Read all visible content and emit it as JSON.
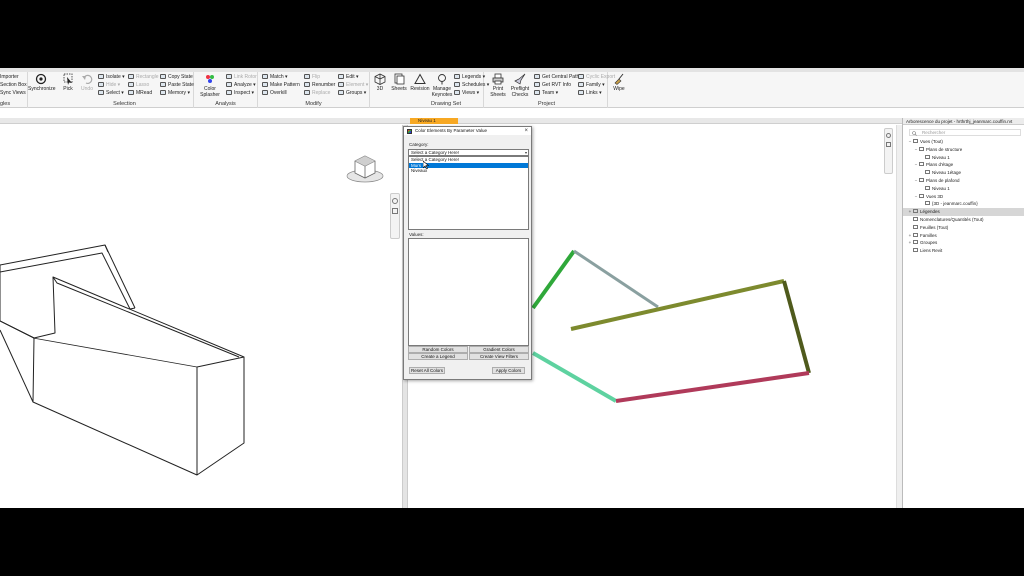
{
  "ribbon": {
    "partial_left": [
      {
        "label": "Importer"
      },
      {
        "label": "Section Box"
      },
      {
        "label": "Sync Views"
      },
      {
        "label": "gles"
      }
    ],
    "synchronize": "Synchronize",
    "pick": "Pick",
    "undo": "Undo",
    "isolate": "Isolate",
    "hide": "Hide",
    "select": "Select",
    "selection_label": "Selection",
    "copy_state": "Copy State",
    "paste_state": "Paste State",
    "memory": "Memory",
    "misc_items": [
      "Rectangle",
      "Lasso",
      "MRead"
    ],
    "color_splasher": "Color Splasher",
    "analysis_items": [
      "Link Rotor",
      "Analyze",
      "Inspect"
    ],
    "analysis_label": "Analysis",
    "match": "Match",
    "make_pattern": "Make Pattern",
    "overkill": "Overkill",
    "renumber": "Renumber",
    "modify_items": [
      "Flip",
      "Replace"
    ],
    "modify_label": "Modify",
    "edit": "Edit",
    "element": "Element",
    "groups": "Groups",
    "threed": "3D",
    "sheets": "Sheets",
    "revision": "Revision",
    "manage_keynotes": "Manage Keynotes",
    "legends": "Legends",
    "schedules": "Schedules",
    "views": "Views",
    "drawing_set_label": "Drawing Set",
    "print_sheets": "Print Sheets",
    "preflight_checks": "Preflight Checks",
    "get_central_path": "Get Central Path",
    "get_rvt_info": "Get RVT Info",
    "team": "Team",
    "cyclic_export": "Cyclic Export",
    "family": "Family",
    "links": "Links",
    "project_label": "Project",
    "wipe": "Wipe"
  },
  "view_tab": {
    "label": "Niveau 1"
  },
  "dialog": {
    "title": "Color Elements By Parameter Value",
    "category_label": "Category:",
    "category_selected": "Select a Category Here!",
    "category_options": [
      "Select a Category Here!",
      "Murs",
      "Niveaux"
    ],
    "highlighted_option": "Murs",
    "values_label": "Values:",
    "random_colors": "Random Colors",
    "gradient_colors": "Gradient Colors",
    "create_legend": "Create a Legend",
    "create_view_filters": "Create View Filters",
    "reset_all_colors": "Reset All Colors",
    "apply_colors": "Apply Colors"
  },
  "browser": {
    "title": "Arborescence du projet - hrthrthj_jeanmarc.couffin.rvt",
    "search_placeholder": "Rechercher",
    "tree": [
      {
        "label": "Vues (Tout)",
        "level": 0,
        "toggle": "−"
      },
      {
        "label": "Plans de structure",
        "level": 1,
        "toggle": "−"
      },
      {
        "label": "Niveau 1",
        "level": 2,
        "toggle": ""
      },
      {
        "label": "Plans d'étage",
        "level": 1,
        "toggle": "−"
      },
      {
        "label": "Niveau 1étage",
        "level": 2,
        "toggle": ""
      },
      {
        "label": "Plans de plafond",
        "level": 1,
        "toggle": "−"
      },
      {
        "label": "Niveau 1",
        "level": 2,
        "toggle": ""
      },
      {
        "label": "Vues 3D",
        "level": 1,
        "toggle": "−"
      },
      {
        "label": "{3D - jeanmarc.couffin}",
        "level": 2,
        "toggle": ""
      },
      {
        "label": "Légendes",
        "level": 0,
        "toggle": "+"
      },
      {
        "label": "Nomenclatures/Quantités (Tout)",
        "level": 0,
        "toggle": ""
      },
      {
        "label": "Feuilles (Tout)",
        "level": 0,
        "toggle": ""
      },
      {
        "label": "Familles",
        "level": 0,
        "toggle": "+"
      },
      {
        "label": "Groupes",
        "level": 0,
        "toggle": "+"
      },
      {
        "label": "Liens Revit",
        "level": 0,
        "toggle": ""
      }
    ],
    "selected_index": 9
  },
  "colors": {
    "wall_green": "#2fa83a",
    "wall_gray": "#8aa0a0",
    "wall_olive": "#7d8a2e",
    "wall_dark_olive": "#4f5a1c",
    "wall_mint": "#5ed2a0",
    "wall_red": "#b03a5a",
    "tab_orange": "#f7a823",
    "highlight_blue": "#0078d7"
  }
}
